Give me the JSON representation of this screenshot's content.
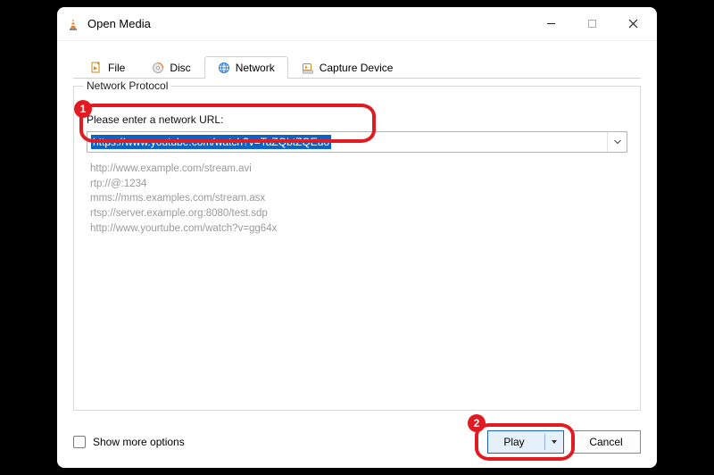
{
  "window": {
    "title": "Open Media"
  },
  "tabs": [
    {
      "label": "File"
    },
    {
      "label": "Disc"
    },
    {
      "label": "Network"
    },
    {
      "label": "Capture Device"
    }
  ],
  "network": {
    "group_title": "Network Protocol",
    "field_label": "Please enter a network URL:",
    "url_value": "https://www.youtube.com/watch?v=TaZQbtZQEuo",
    "examples": [
      "http://www.example.com/stream.avi",
      "rtp://@:1234",
      "mms://mms.examples.com/stream.asx",
      "rtsp://server.example.org:8080/test.sdp",
      "http://www.yourtube.com/watch?v=gg64x"
    ]
  },
  "footer": {
    "show_more_label": "Show more options",
    "play_label": "Play",
    "cancel_label": "Cancel"
  },
  "annotations": {
    "badge1": "1",
    "badge2": "2"
  }
}
